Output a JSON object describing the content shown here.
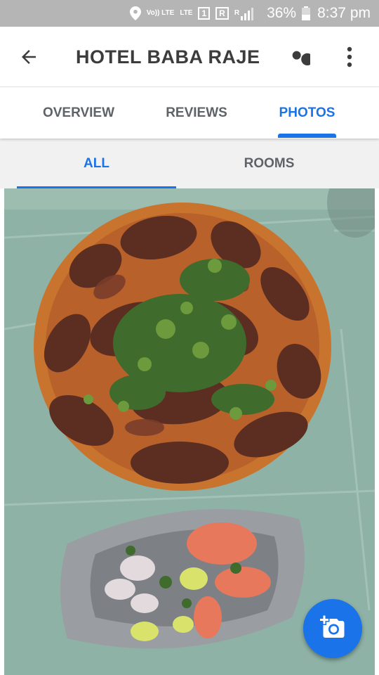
{
  "status_bar": {
    "volte_label": "Vo)) LTE",
    "lte_label": "LTE",
    "sim_label": "1",
    "roaming_label": "R",
    "signal_label": "R",
    "battery_percent": "36%",
    "time": "8:37 pm"
  },
  "app_bar": {
    "title": "HOTEL BABA RAJE"
  },
  "tabs": [
    {
      "label": "OVERVIEW",
      "active": false
    },
    {
      "label": "REVIEWS",
      "active": false
    },
    {
      "label": "PHOTOS",
      "active": true
    }
  ],
  "subtabs": [
    {
      "label": "ALL",
      "active": true
    },
    {
      "label": "ROOMS",
      "active": false
    }
  ],
  "photo": {
    "icon": "photo-fried-fish-plate"
  },
  "fab": {
    "icon": "add-photo-icon"
  },
  "colors": {
    "accent": "#1a73e8",
    "status_bar": "#b5b5b5",
    "tab_text": "#5f6368"
  }
}
